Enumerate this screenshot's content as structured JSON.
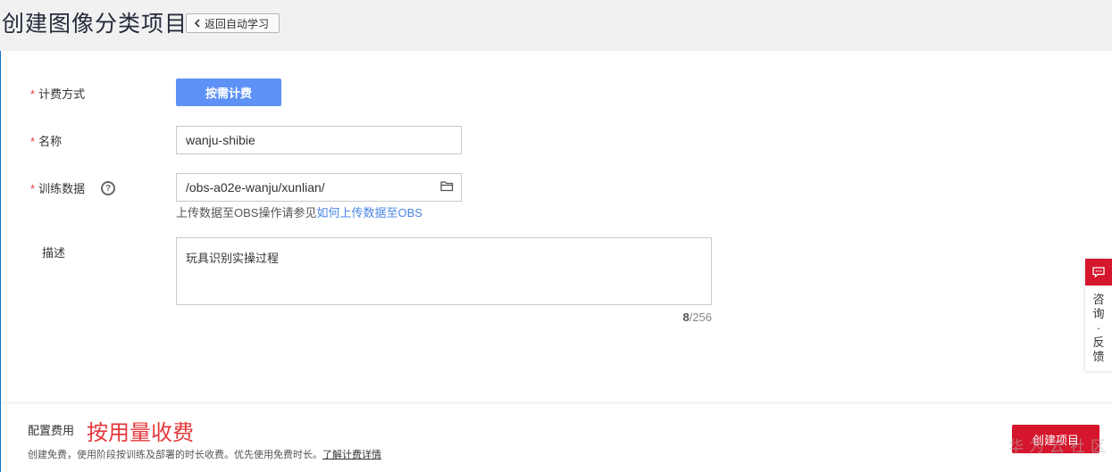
{
  "header": {
    "title": "创建图像分类项目",
    "back_label": "返回自动学习"
  },
  "form": {
    "billing": {
      "label": "计费方式",
      "value": "按需计费"
    },
    "name": {
      "label": "名称",
      "value": "wanju-shibie"
    },
    "training_data": {
      "label": "训练数据",
      "value": "/obs-a02e-wanju/xunlian/",
      "hint_text": "上传数据至OBS操作请参见",
      "hint_link": "如何上传数据至OBS"
    },
    "description": {
      "label": "描述",
      "value": "玩具识别实操过程",
      "count": "8",
      "max": "/256"
    }
  },
  "footer": {
    "fee_label": "配置费用",
    "fee_value": "按用量收费",
    "note": "创建免费，使用阶段按训练及部署的时长收费。优先使用免费时长。",
    "note_link": "了解计费详情",
    "create_label": "创建项目",
    "watermark": "华为云社区"
  },
  "side_widget": {
    "chars": [
      "咨",
      "询",
      "·",
      "反",
      "馈"
    ]
  },
  "colors": {
    "accent_red": "#d5162c",
    "primary_blue": "#5e91f5",
    "link_blue": "#4b86e6"
  }
}
